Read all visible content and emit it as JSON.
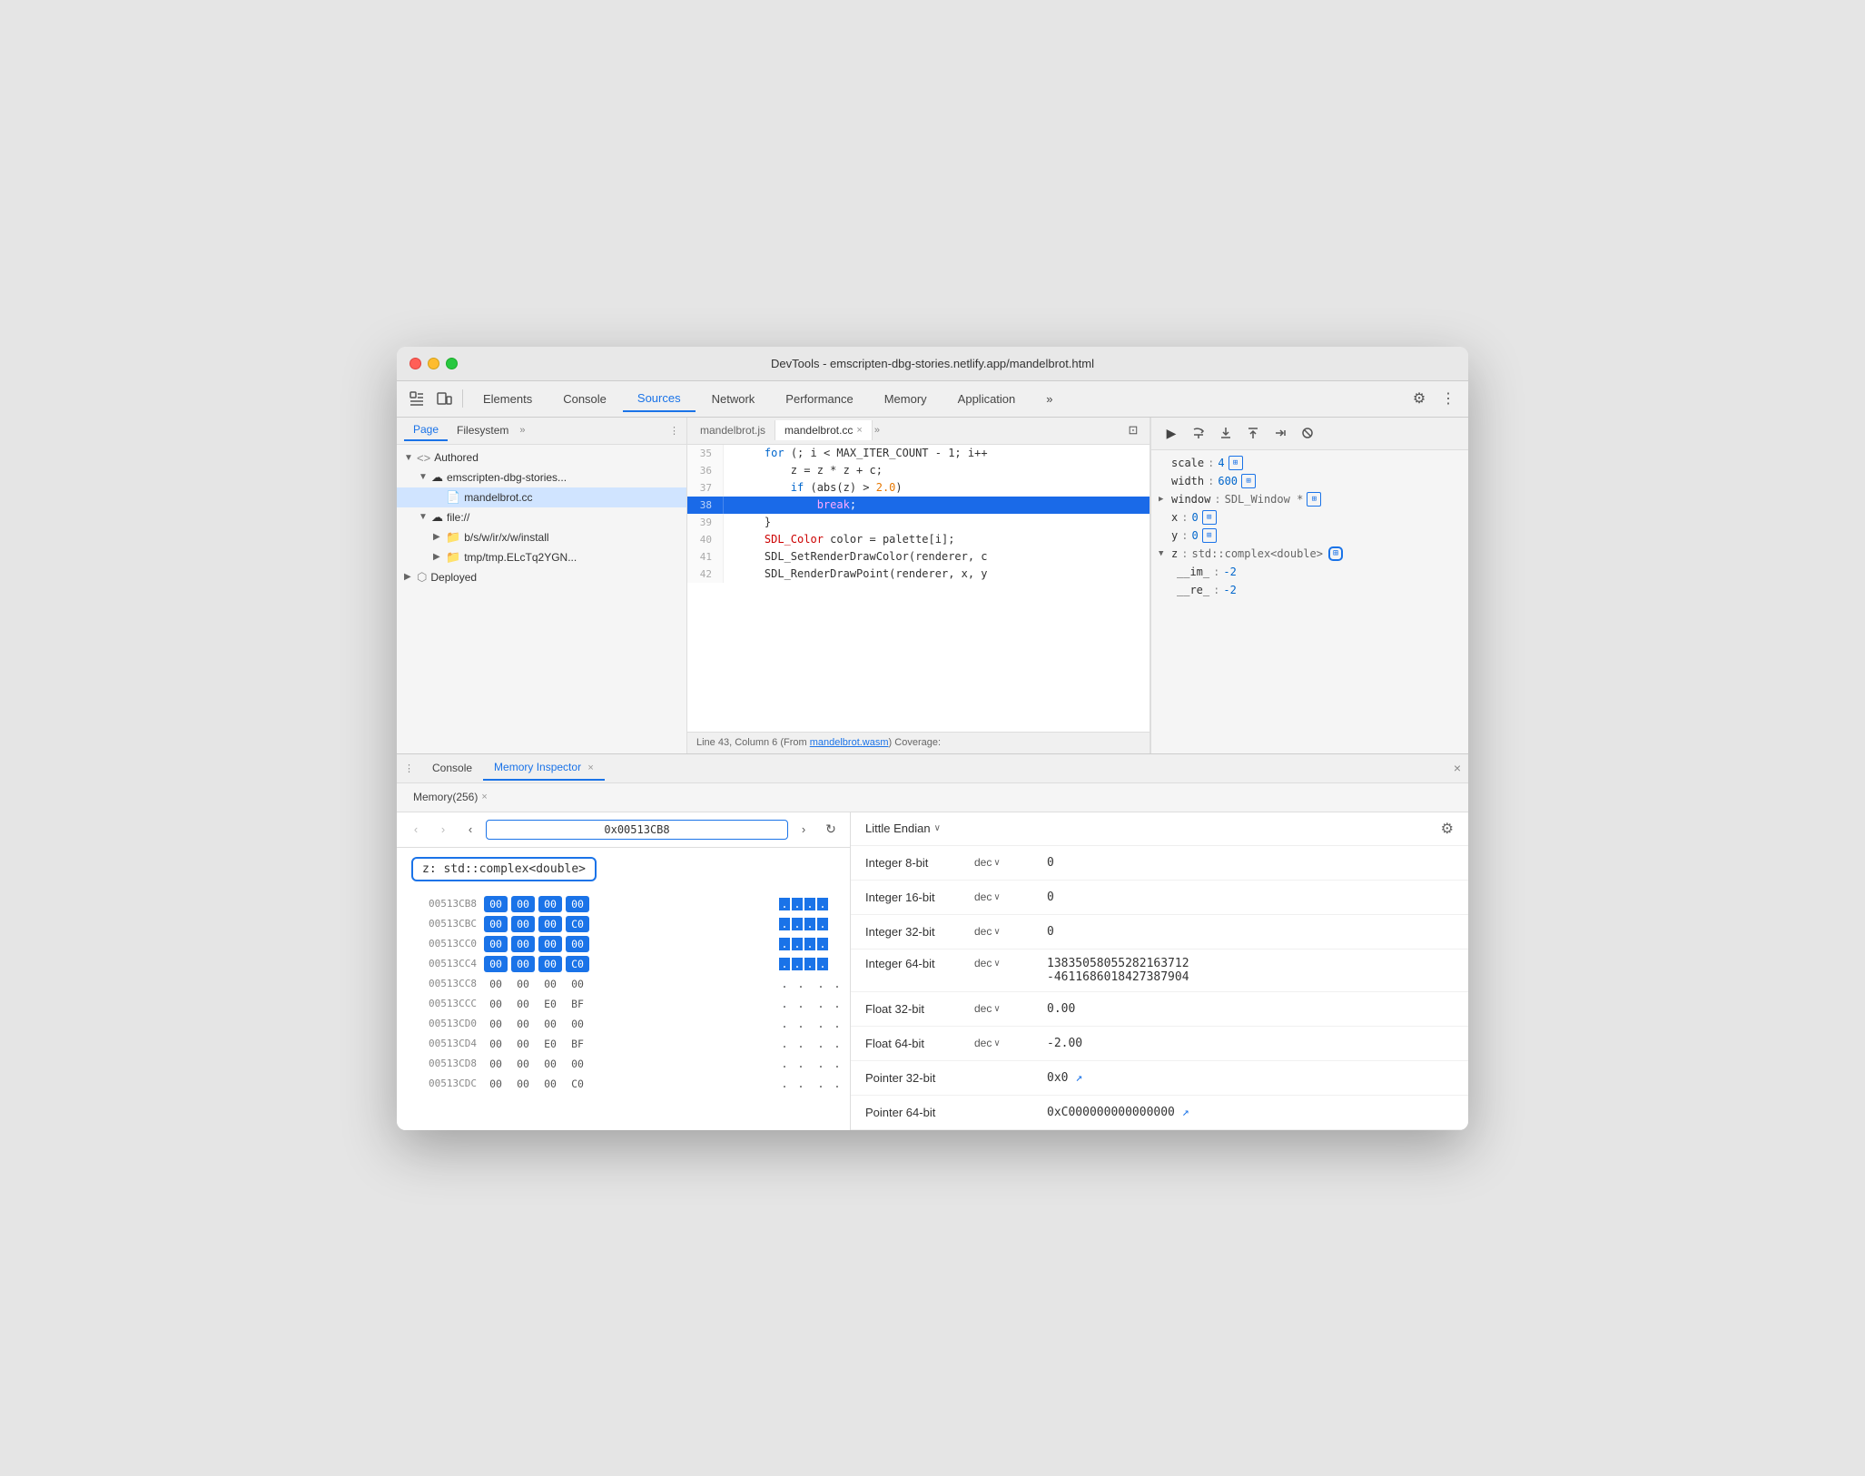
{
  "window": {
    "title": "DevTools - emscripten-dbg-stories.netlify.app/mandelbrot.html"
  },
  "toolbar": {
    "tabs": [
      "Elements",
      "Console",
      "Sources",
      "Network",
      "Performance",
      "Memory",
      "Application"
    ],
    "active_tab": "Sources",
    "more_label": "»",
    "settings_label": "⚙",
    "more_menu_label": "⋮"
  },
  "left_panel": {
    "tabs": [
      "Page",
      "Filesystem"
    ],
    "more_label": "»",
    "menu_label": "⋮",
    "active_tab": "Page",
    "tree": [
      {
        "level": 0,
        "arrow": "▼",
        "icon": "<>",
        "label": "Authored"
      },
      {
        "level": 1,
        "arrow": "▼",
        "icon": "☁",
        "label": "emscripten-dbg-stories..."
      },
      {
        "level": 2,
        "arrow": "",
        "icon": "📄",
        "label": "mandelbrot.cc",
        "selected": true
      },
      {
        "level": 1,
        "arrow": "▼",
        "icon": "☁",
        "label": "file://"
      },
      {
        "level": 2,
        "arrow": "▶",
        "icon": "📁",
        "label": "b/s/w/ir/x/w/install"
      },
      {
        "level": 2,
        "arrow": "▶",
        "icon": "📁",
        "label": "tmp/tmp.ELcTq2YGN..."
      },
      {
        "level": 0,
        "arrow": "▶",
        "icon": "⬡",
        "label": "Deployed"
      }
    ]
  },
  "code_panel": {
    "tabs": [
      "mandelbrot.js",
      "mandelbrot.cc"
    ],
    "active_tab": "mandelbrot.cc",
    "close_label": "×",
    "more_label": "»",
    "lines": [
      {
        "num": 35,
        "content": "    for (; i < MAX_ITER_COUNT - 1; i++",
        "highlight": false
      },
      {
        "num": 36,
        "content": "        z = z * z + c;",
        "highlight": false
      },
      {
        "num": 37,
        "content": "        if (abs(z) > 2.0)",
        "highlight": false
      },
      {
        "num": 38,
        "content": "            break;",
        "highlight": true
      },
      {
        "num": 39,
        "content": "    }",
        "highlight": false
      },
      {
        "num": 40,
        "content": "    SDL_Color color = palette[i];",
        "highlight": false
      },
      {
        "num": 41,
        "content": "    SDL_SetRenderDrawColor(renderer, c",
        "highlight": false
      },
      {
        "num": 42,
        "content": "    SDL_RenderDrawPoint(renderer, x, y",
        "highlight": false
      }
    ],
    "status": "Line 43, Column 6 (From mandelbrot.wasm) Coverage:"
  },
  "debug_panel": {
    "buttons": [
      "▶",
      "↺",
      "⬇",
      "⬆",
      "➡",
      "↩"
    ],
    "vars": [
      {
        "indent": 0,
        "name": "scale",
        "sep": ":",
        "value": "4",
        "icon": "⊞"
      },
      {
        "indent": 0,
        "name": "width",
        "sep": ":",
        "value": "600",
        "icon": "⊞"
      },
      {
        "indent": 0,
        "arrow": "▶",
        "name": "window",
        "sep": ":",
        "value": "SDL_Window *",
        "icon": "⊞"
      },
      {
        "indent": 0,
        "name": "x",
        "sep": ":",
        "value": "0",
        "icon": "⊞"
      },
      {
        "indent": 0,
        "name": "y",
        "sep": ":",
        "value": "0",
        "icon": "⊞"
      },
      {
        "indent": 0,
        "arrow": "▼",
        "name": "z",
        "sep": ":",
        "value": "std::complex<double>",
        "icon": "⊞",
        "icon_highlighted": true
      },
      {
        "indent": 1,
        "name": "__im_",
        "sep": ":",
        "value": "-2"
      },
      {
        "indent": 1,
        "name": "__re_",
        "sep": ":",
        "value": "-2"
      }
    ]
  },
  "bottom": {
    "tabs": [
      "Console",
      "Memory Inspector"
    ],
    "active_tab": "Memory Inspector",
    "close_label": "×",
    "close_btn": "×",
    "memory_tabs": [
      "Memory(256)"
    ],
    "memory_tab_close": "×"
  },
  "memory_nav": {
    "back_label": "←",
    "forward_label": "→",
    "back_arrow": "‹",
    "forward_arrow": "›",
    "address": "0x00513CB8",
    "refresh_label": "↻"
  },
  "var_label": "z: std::complex<double>",
  "hex_rows": [
    {
      "addr": "00513CB8",
      "bytes": [
        "00",
        "00",
        "00",
        "00"
      ],
      "highlighted": [
        true,
        true,
        true,
        true
      ],
      "chars": [
        ".",
        ".",
        ".",
        "."
      ]
    },
    {
      "addr": "00513CBC",
      "bytes": [
        "00",
        "00",
        "00",
        "C0"
      ],
      "highlighted": [
        true,
        true,
        true,
        true
      ],
      "chars": [
        ".",
        ".",
        ".",
        "."
      ]
    },
    {
      "addr": "00513CC0",
      "bytes": [
        "00",
        "00",
        "00",
        "00"
      ],
      "highlighted": [
        true,
        true,
        true,
        true
      ],
      "chars": [
        ".",
        ".",
        ".",
        "."
      ]
    },
    {
      "addr": "00513CC4",
      "bytes": [
        "00",
        "00",
        "00",
        "C0"
      ],
      "highlighted": [
        true,
        true,
        true,
        true
      ],
      "chars": [
        ".",
        ".",
        ".",
        "."
      ]
    },
    {
      "addr": "00513CC8",
      "bytes": [
        "00",
        "00",
        "00",
        "00"
      ],
      "highlighted": [
        false,
        false,
        false,
        false
      ],
      "chars": [
        ".",
        ".",
        ".",
        "."
      ]
    },
    {
      "addr": "00513CCC",
      "bytes": [
        "00",
        "00",
        "E0",
        "BF"
      ],
      "highlighted": [
        false,
        false,
        false,
        false
      ],
      "chars": [
        ".",
        ".",
        ".",
        "."
      ]
    },
    {
      "addr": "00513CD0",
      "bytes": [
        "00",
        "00",
        "00",
        "00"
      ],
      "highlighted": [
        false,
        false,
        false,
        false
      ],
      "chars": [
        ".",
        ".",
        ".",
        "."
      ]
    },
    {
      "addr": "00513CD4",
      "bytes": [
        "00",
        "00",
        "E0",
        "BF"
      ],
      "highlighted": [
        false,
        false,
        false,
        false
      ],
      "chars": [
        ".",
        ".",
        ".",
        "."
      ]
    },
    {
      "addr": "00513CD8",
      "bytes": [
        "00",
        "00",
        "00",
        "00"
      ],
      "highlighted": [
        false,
        false,
        false,
        false
      ],
      "chars": [
        ".",
        ".",
        ".",
        "."
      ]
    },
    {
      "addr": "00513CDC",
      "bytes": [
        "00",
        "00",
        "00",
        "C0"
      ],
      "highlighted": [
        false,
        false,
        false,
        false
      ],
      "chars": [
        ".",
        ".",
        ".",
        "."
      ]
    }
  ],
  "endian": {
    "label": "Little Endian",
    "chevron": "∨"
  },
  "interpretations": [
    {
      "type": "Integer 8-bit",
      "format": "dec",
      "value": "0"
    },
    {
      "type": "Integer 16-bit",
      "format": "dec",
      "value": "0"
    },
    {
      "type": "Integer 32-bit",
      "format": "dec",
      "value": "0"
    },
    {
      "type": "Integer 64-bit",
      "format": "dec",
      "value": "13835058055282163712"
    },
    {
      "type": "",
      "format": "",
      "value": "-4611686018427387904"
    },
    {
      "type": "Float 32-bit",
      "format": "dec",
      "value": "0.00"
    },
    {
      "type": "Float 64-bit",
      "format": "dec",
      "value": "-2.00"
    },
    {
      "type": "Pointer 32-bit",
      "format": "",
      "value": "0x0",
      "link": true
    },
    {
      "type": "Pointer 64-bit",
      "format": "",
      "value": "0xC000000000000000",
      "link": true
    }
  ]
}
